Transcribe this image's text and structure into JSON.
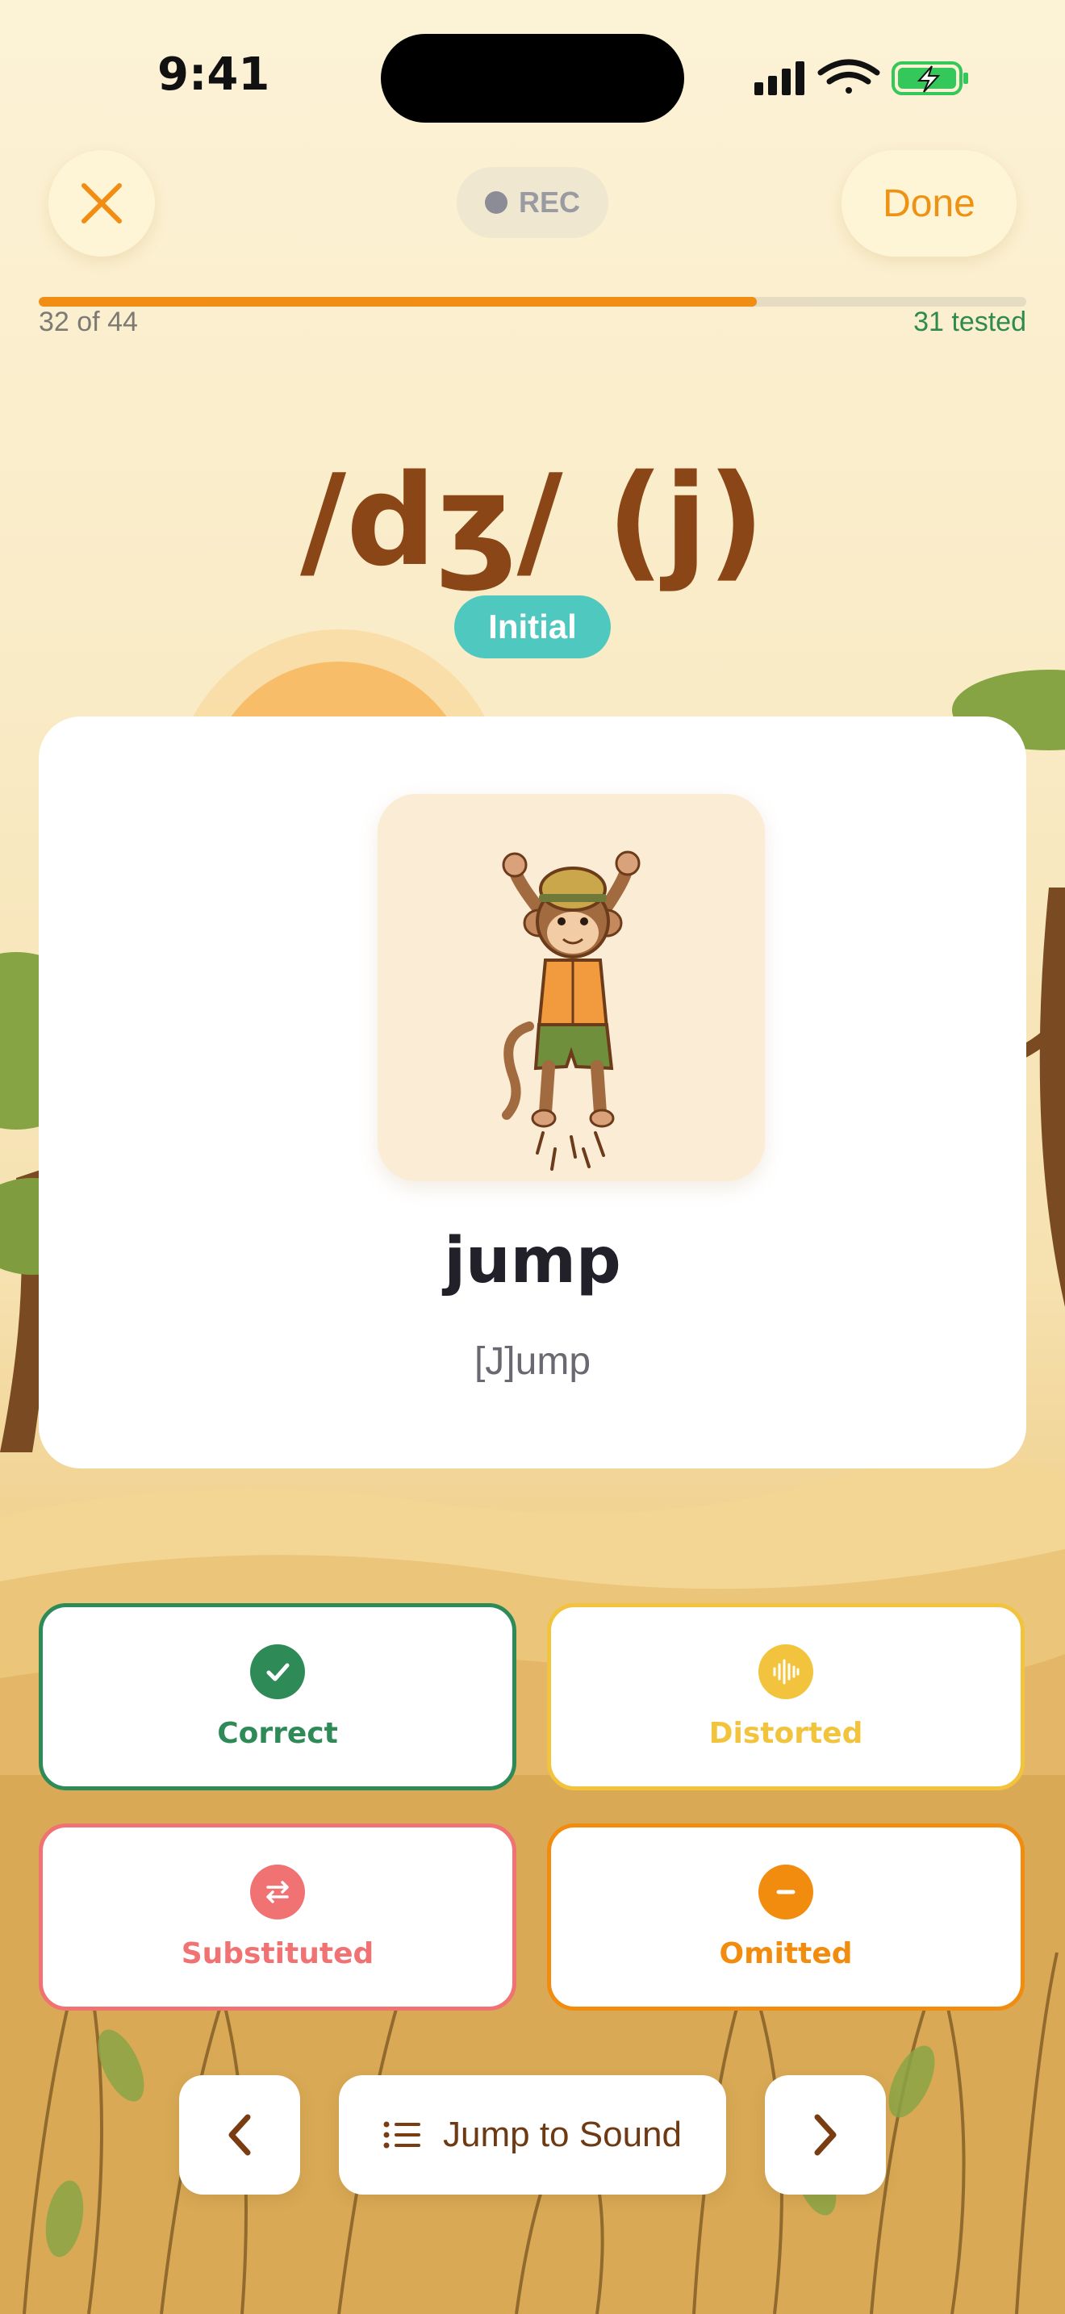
{
  "status_bar": {
    "time": "9:41"
  },
  "header": {
    "close_icon": "close-x-icon",
    "rec_label": "REC",
    "done_label": "Done"
  },
  "progress": {
    "current": 32,
    "total": 44,
    "fraction": 0.727,
    "position_text": "32 of 44",
    "tested_text": "31 tested"
  },
  "sound": {
    "symbol": "/dʒ/ (j)",
    "position": "Initial"
  },
  "card": {
    "image": "monkey-jumping-illustration",
    "word": "jump",
    "transcription": "[J]ump"
  },
  "ratings": [
    {
      "label": "Correct",
      "icon": "checkmark-icon",
      "color": "#2e8b57"
    },
    {
      "label": "Distorted",
      "icon": "waveform-icon",
      "color": "#f2c43d"
    },
    {
      "label": "Substituted",
      "icon": "swap-arrows-icon",
      "color": "#f07272"
    },
    {
      "label": "Omitted",
      "icon": "minus-icon",
      "color": "#f28c0f"
    }
  ],
  "bottom_nav": {
    "prev_icon": "chevron-left-icon",
    "jump_label": "Jump to Sound",
    "jump_icon": "list-icon",
    "next_icon": "chevron-right-icon"
  },
  "colors": {
    "accent": "#f08d12",
    "brown": "#8a4616",
    "teal": "#4fc8c0",
    "green": "#2f8a4e"
  }
}
